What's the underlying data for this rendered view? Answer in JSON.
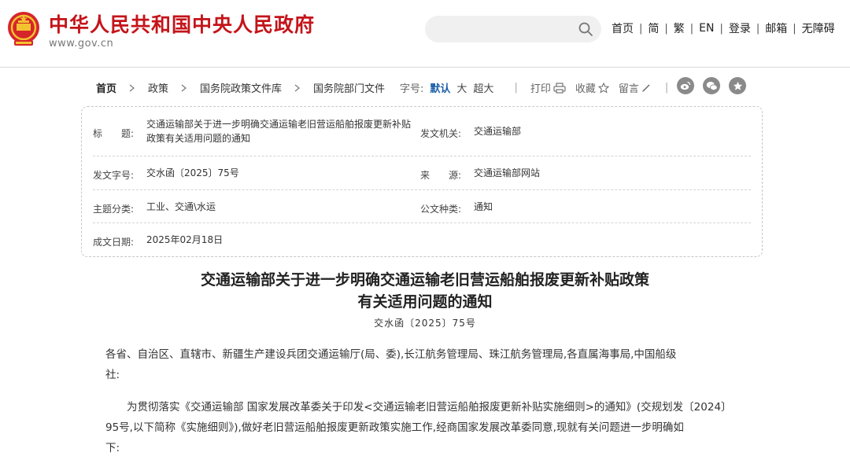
{
  "header": {
    "site_title": "中华人民共和国中央人民政府",
    "site_url": "www.gov.cn",
    "search_placeholder": "",
    "nav": [
      "首页",
      "简",
      "繁",
      "EN",
      "登录",
      "邮箱",
      "无障碍"
    ]
  },
  "breadcrumb": [
    "首页",
    "政策",
    "国务院政策文件库",
    "国务院部门文件"
  ],
  "toolbar": {
    "font_size_label": "字号:",
    "font_sizes": [
      "默认",
      "大",
      "超大"
    ],
    "active_font_size": "默认",
    "print_label": "打印",
    "favorite_label": "收藏",
    "comment_label": "留言"
  },
  "share": [
    "weibo-icon",
    "wechat-icon",
    "star-icon"
  ],
  "info": {
    "title_label": "标　　题:",
    "title_value_line1": "交通运输部关于进一步明确交通运输老旧营运船舶报废更新补贴",
    "title_value_line2": "政策有关适用问题的通知",
    "issuer_label": "发文机关:",
    "issuer_value": "交通运输部",
    "doc_number_label": "发文字号:",
    "doc_number_value": "交水函〔2025〕75号",
    "source_label": "来　　源:",
    "source_value": "交通运输部网站",
    "category_label": "主题分类:",
    "category_value": "工业、交通\\水运",
    "doc_type_label": "公文种类:",
    "doc_type_value": "通知",
    "date_label": "成文日期:",
    "date_value": "2025年02月18日"
  },
  "article": {
    "title_line1": "交通运输部关于进一步明确交通运输老旧营运船舶报废更新补贴政策",
    "title_line2": "有关适用问题的通知",
    "doc_number": "交水函〔2025〕75号",
    "recipients_line1": "各省、自治区、直辖市、新疆生产建设兵团交通运输厅(局、委),长江航务管理局、珠江航务管理局,各直属海事局,中国船级",
    "recipients_line2": "社:",
    "body_line1": "为贯彻落实《交通运输部 国家发展改革委关于印发<交通运输老旧营运船舶报废更新补贴实施细则>的通知》(交规划发〔2024〕",
    "body_line2": "95号,以下简称《实施细则》),做好老旧营运船舶报废更新政策实施工作,经商国家发展改革委同意,现就有关问题进一步明确如",
    "body_line3": "下:"
  },
  "colors": {
    "brand_red": "#c4141a",
    "link_blue": "#1a5ea8",
    "share_gray": "#8a8a8a"
  }
}
